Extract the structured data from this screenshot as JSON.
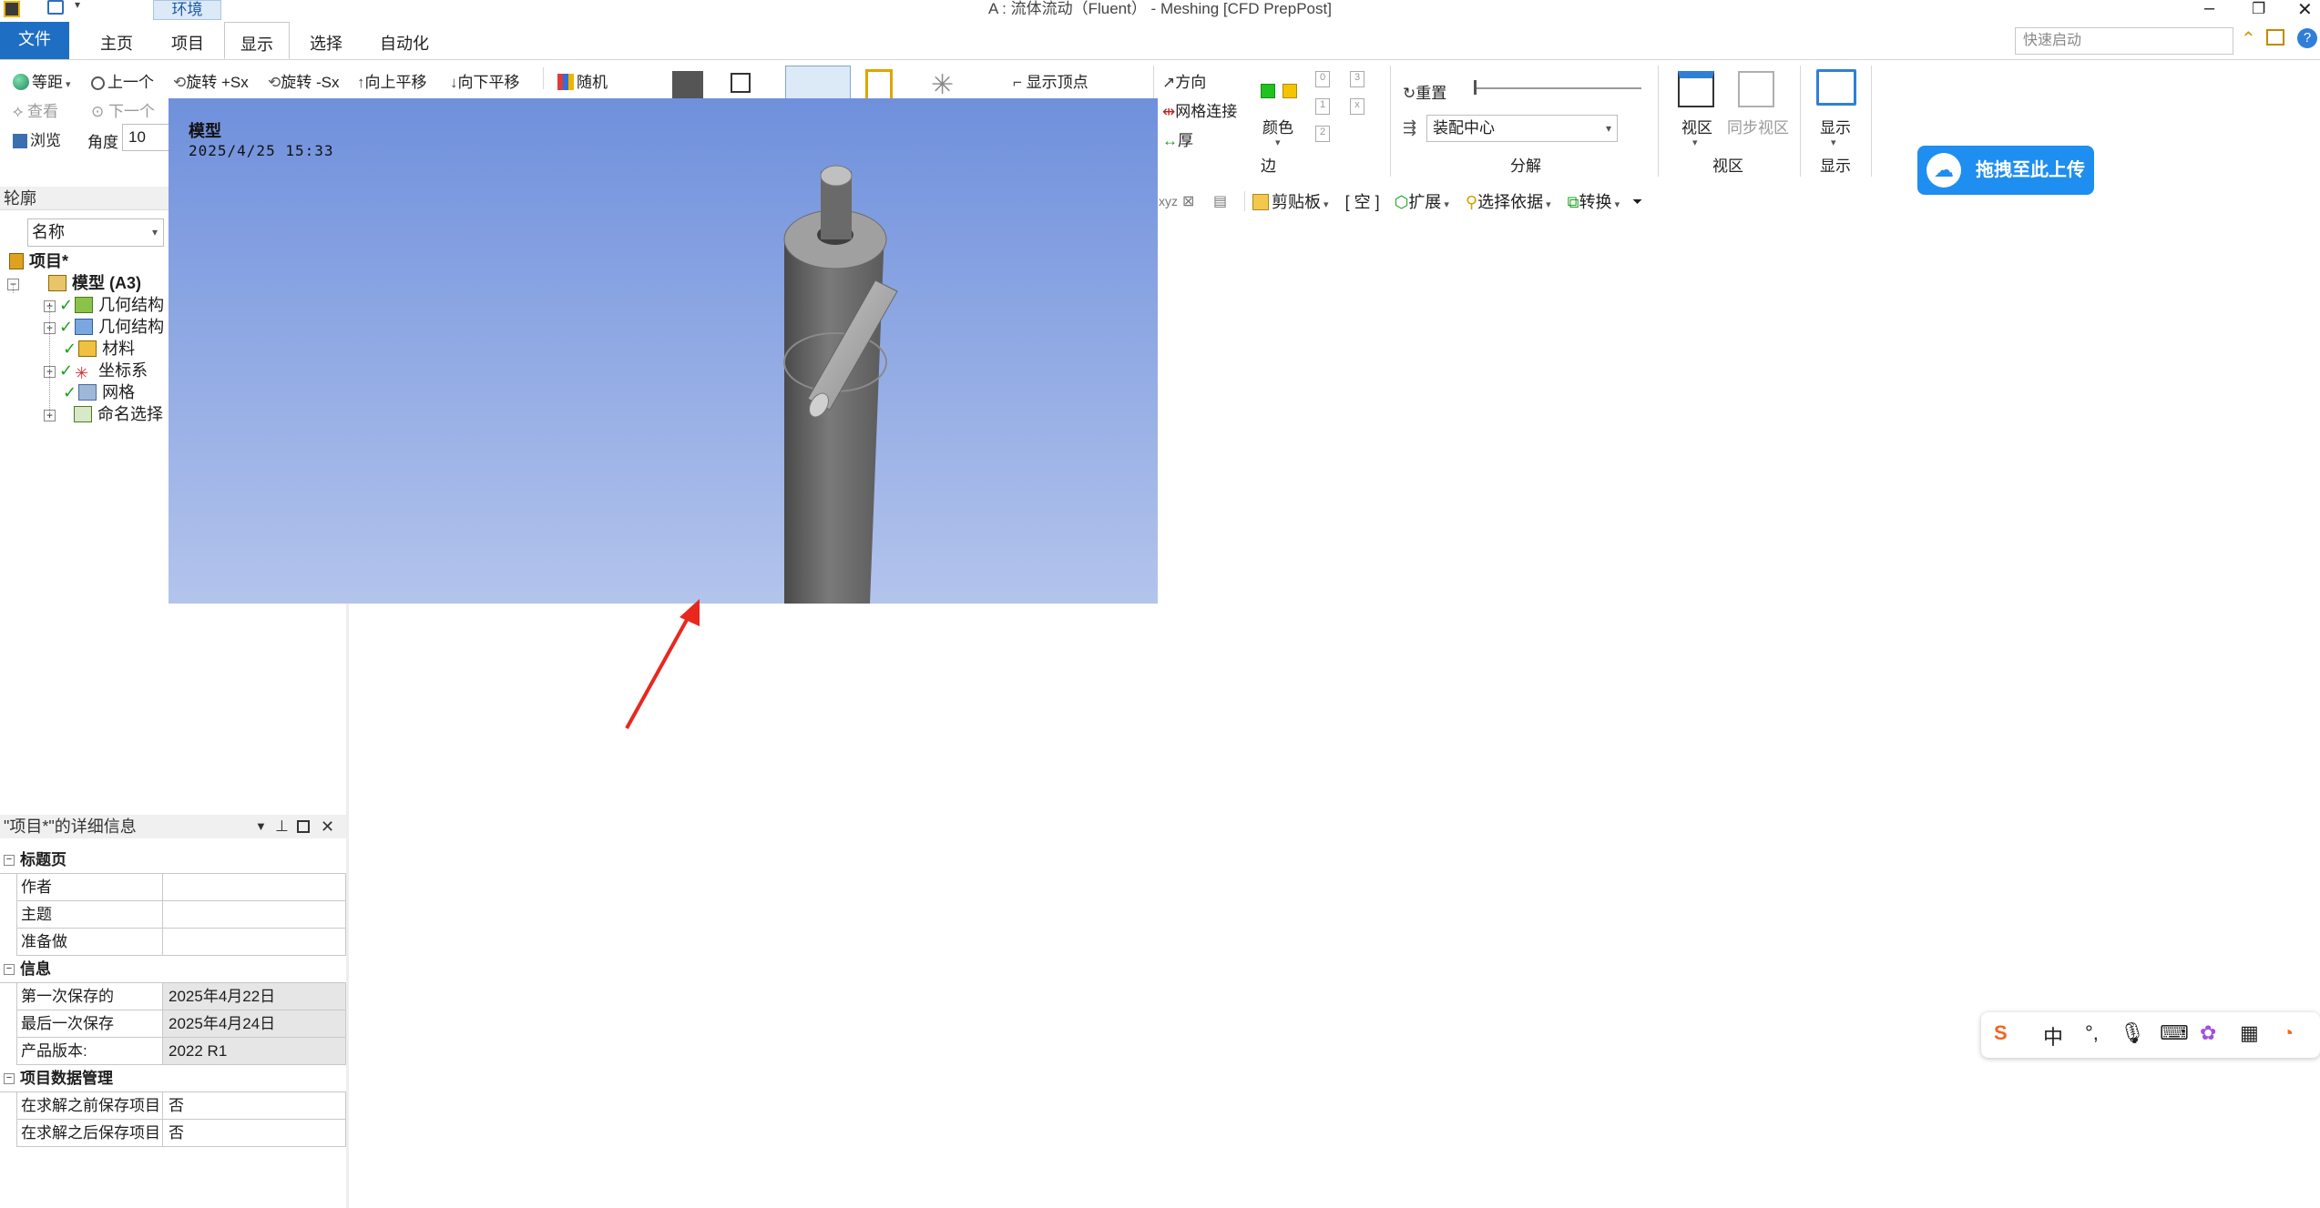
{
  "titlebar": {
    "env_tab": "环境",
    "title": "A : 流体流动（Fluent） - Meshing [CFD PrepPost]"
  },
  "tabs": {
    "file": "文件",
    "items": [
      "主页",
      "项目",
      "显示",
      "选择",
      "自动化"
    ],
    "active": "显示",
    "quick_launch_placeholder": "快速启动"
  },
  "ribbon": {
    "isometric": "等距",
    "view_prev": "上一个",
    "rotate_plus": "旋转 +Sx",
    "rotate_minus": "旋转 -Sx",
    "pan_up": "向上平移",
    "pan_down": "向下平移",
    "random": "随机",
    "look_at": "查看",
    "view_next": "下一个",
    "browse": "浏览",
    "angle_label": "角度",
    "angle_value": "10",
    "show_vertices": "显示顶点",
    "direction": "方向",
    "mesh_connect": "网格连接",
    "thickness": "厚",
    "color": "颜色",
    "edge_group": "边",
    "reset": "重置",
    "explode_center": "装配中心",
    "explode_group": "分解",
    "viewport": "视区",
    "sync_viewport": "同步视区",
    "viewport_group": "视区",
    "display": "显示",
    "display_group": "显示"
  },
  "toolbar2": {
    "clipboard": "剪贴板",
    "empty": "[ 空 ]",
    "extend": "扩展",
    "select_by": "选择依据",
    "convert": "转换"
  },
  "outline": {
    "header": "轮廓",
    "name_dropdown": "名称",
    "tree": [
      {
        "label": "项目*",
        "level": 0,
        "expander": "",
        "check": false
      },
      {
        "label": "模型 (A3)",
        "level": 1,
        "expander": "−",
        "check": false
      },
      {
        "label": "几何结构",
        "level": 2,
        "expander": "+",
        "check": true
      },
      {
        "label": "几何结构",
        "level": 2,
        "expander": "+",
        "check": true
      },
      {
        "label": "材料",
        "level": 2,
        "expander": "",
        "check": true
      },
      {
        "label": "坐标系",
        "level": 2,
        "expander": "+",
        "check": true
      },
      {
        "label": "网格",
        "level": 2,
        "expander": "",
        "check": true
      },
      {
        "label": "命名选择",
        "level": 2,
        "expander": "+",
        "check": false
      }
    ]
  },
  "details": {
    "header": "\"项目*\"的详细信息",
    "sections": [
      {
        "title": "标题页",
        "rows": [
          {
            "key": "作者",
            "value": "",
            "shade": false
          },
          {
            "key": "主题",
            "value": "",
            "shade": false
          },
          {
            "key": "准备做",
            "value": "",
            "shade": false
          }
        ]
      },
      {
        "title": "信息",
        "rows": [
          {
            "key": "第一次保存的",
            "value": "2025年4月22日",
            "shade": true
          },
          {
            "key": "最后一次保存",
            "value": "2025年4月24日",
            "shade": true
          },
          {
            "key": "产品版本:",
            "value": "2022 R1",
            "shade": true
          }
        ]
      },
      {
        "title": "项目数据管理",
        "rows": [
          {
            "key": "在求解之前保存项目",
            "value": "否",
            "shade": false
          },
          {
            "key": "在求解之后保存项目",
            "value": "否",
            "shade": false
          }
        ]
      }
    ]
  },
  "viewport": {
    "label": "模型",
    "timestamp": "2025/4/25 15:33"
  },
  "upload_button": "拖拽至此上传",
  "ime": {
    "lang": "中"
  },
  "colors": {
    "file_tab": "#1e6fc4",
    "upload": "#1e8ef0",
    "viewport_top": "#6f90dc",
    "viewport_bottom": "#b3c4ec",
    "arrow": "#e8281e"
  }
}
